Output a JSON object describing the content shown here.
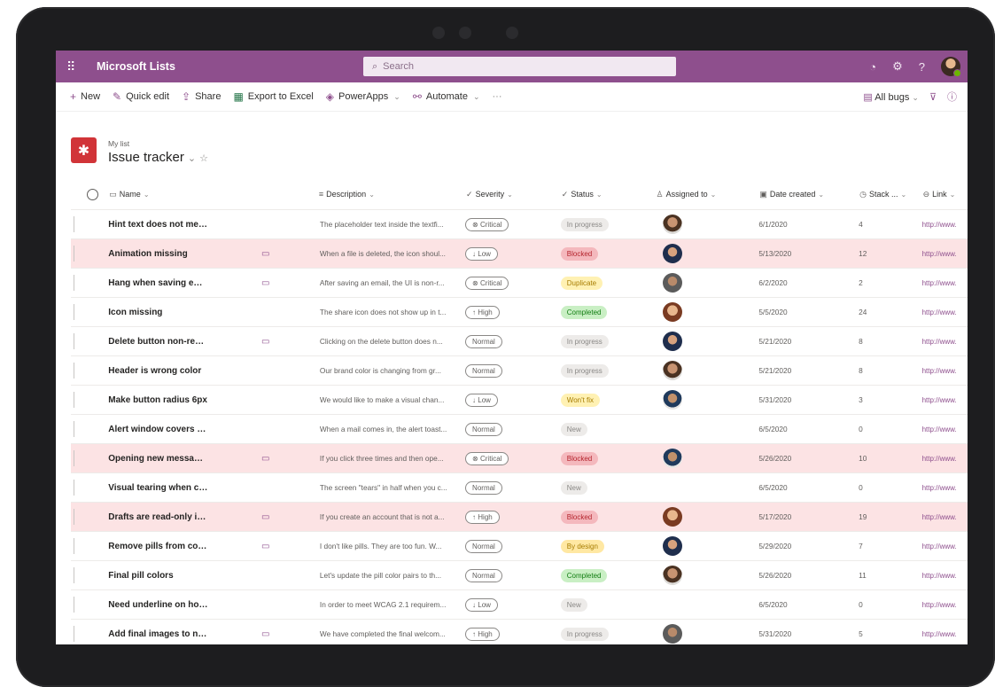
{
  "app": {
    "name": "Microsoft Lists",
    "search_placeholder": "Search"
  },
  "suite_icons": [
    "bell-icon",
    "gear-icon",
    "help-icon"
  ],
  "help_label": "?",
  "commands": {
    "new": "New",
    "quick_edit": "Quick edit",
    "share": "Share",
    "export": "Export to Excel",
    "powerapps": "PowerApps",
    "automate": "Automate",
    "more": "···",
    "view": "All bugs"
  },
  "list": {
    "subtitle": "My list",
    "title": "Issue tracker"
  },
  "columns": {
    "name": "Name",
    "description": "Description",
    "severity": "Severity",
    "status": "Status",
    "assigned": "Assigned to",
    "date": "Date created",
    "stack": "Stack ...",
    "link": "Link"
  },
  "rows": [
    {
      "name": "Hint text does not meet contrast",
      "comment": false,
      "desc": "The placeholder text inside the textfi...",
      "sev": "Critical",
      "status": "In progress",
      "avatar": "a1",
      "date": "6/1/2020",
      "stack": "4",
      "link": "http://www.",
      "selected": false
    },
    {
      "name": "Animation missing",
      "comment": true,
      "desc": "When a file is deleted, the icon shoul...",
      "sev": "Low",
      "status": "Blocked",
      "avatar": "a2",
      "date": "5/13/2020",
      "stack": "12",
      "link": "http://www.",
      "selected": true
    },
    {
      "name": "Hang when saving email",
      "comment": true,
      "desc": "After saving an email, the UI is non-r...",
      "sev": "Critical",
      "status": "Duplicate",
      "avatar": "a3",
      "date": "6/2/2020",
      "stack": "2",
      "link": "http://www.",
      "selected": false
    },
    {
      "name": "Icon missing",
      "comment": false,
      "desc": "The share icon does not show up in t...",
      "sev": "High",
      "status": "Completed",
      "avatar": "a4",
      "date": "5/5/2020",
      "stack": "24",
      "link": "http://www.",
      "selected": false
    },
    {
      "name": "Delete button non-responsive",
      "comment": true,
      "desc": "Clicking on the delete button does n...",
      "sev": "Normal",
      "status": "In progress",
      "avatar": "a2",
      "date": "5/21/2020",
      "stack": "8",
      "link": "http://www.",
      "selected": false
    },
    {
      "name": "Header is wrong color",
      "comment": false,
      "desc": "Our brand color is changing from gr...",
      "sev": "Normal",
      "status": "In progress",
      "avatar": "a1",
      "date": "5/21/2020",
      "stack": "8",
      "link": "http://www.",
      "selected": false
    },
    {
      "name": "Make button radius 6px",
      "comment": false,
      "desc": "We would like to make a visual chan...",
      "sev": "Low",
      "status": "Won't fix",
      "avatar": "a5",
      "date": "5/31/2020",
      "stack": "3",
      "link": "http://www.",
      "selected": false
    },
    {
      "name": "Alert window covers up command ...",
      "comment": false,
      "desc": "When a mail comes in, the alert toast...",
      "sev": "Normal",
      "status": "New",
      "avatar": "",
      "date": "6/5/2020",
      "stack": "0",
      "link": "http://www.",
      "selected": false
    },
    {
      "name": "Opening new message crashes syst...",
      "comment": true,
      "desc": "If you click three times and then ope...",
      "sev": "Critical",
      "status": "Blocked",
      "avatar": "a5",
      "date": "5/26/2020",
      "stack": "10",
      "link": "http://www.",
      "selected": true
    },
    {
      "name": "Visual tearing when closing dialog",
      "comment": false,
      "desc": "The screen \"tears\" in half when you c...",
      "sev": "Normal",
      "status": "New",
      "avatar": "",
      "date": "6/5/2020",
      "stack": "0",
      "link": "http://www.",
      "selected": false
    },
    {
      "name": "Drafts are read-only in external acc...",
      "comment": true,
      "desc": "If you create an account that is not a...",
      "sev": "High",
      "status": "Blocked",
      "avatar": "a4",
      "date": "5/17/2020",
      "stack": "19",
      "link": "http://www.",
      "selected": true
    },
    {
      "name": "Remove pills from column formatti...",
      "comment": true,
      "desc": "I don't like pills. They are too fun. W...",
      "sev": "Normal",
      "status": "By design",
      "avatar": "a2",
      "date": "5/29/2020",
      "stack": "7",
      "link": "http://www.",
      "selected": false
    },
    {
      "name": "Final pill colors",
      "comment": false,
      "desc": "Let's update the pill color pairs to th...",
      "sev": "Normal",
      "status": "Completed",
      "avatar": "a1",
      "date": "5/26/2020",
      "stack": "11",
      "link": "http://www.",
      "selected": false
    },
    {
      "name": "Need underline on hover of help li...",
      "comment": false,
      "desc": "In order to meet WCAG 2.1 requirem...",
      "sev": "Low",
      "status": "New",
      "avatar": "",
      "date": "6/5/2020",
      "stack": "0",
      "link": "http://www.",
      "selected": false
    },
    {
      "name": "Add final images to new message s...",
      "comment": true,
      "desc": "We have completed the final welcom...",
      "sev": "High",
      "status": "In progress",
      "avatar": "a3",
      "date": "5/31/2020",
      "stack": "5",
      "link": "http://www.",
      "selected": false
    }
  ],
  "severity_icons": {
    "Critical": "⊗",
    "Low": "↓",
    "High": "↑",
    "Normal": ""
  },
  "status_colors": {
    "In progress": {
      "bg": "#edebe9",
      "fg": "#8a8886"
    },
    "Blocked": {
      "bg": "#f4b8bd",
      "fg": "#b4232c"
    },
    "Duplicate": {
      "bg": "#fff1b3",
      "fg": "#a67c00"
    },
    "Completed": {
      "bg": "#c9efc4",
      "fg": "#107c10"
    },
    "Won't fix": {
      "bg": "#fff1b3",
      "fg": "#a67c00"
    },
    "New": {
      "bg": "#edebe9",
      "fg": "#8a8886"
    },
    "By design": {
      "bg": "#ffe8a3",
      "fg": "#a67c00"
    }
  },
  "colors": {
    "accent": "#8e4f8d",
    "selected_row": "#fce3e4",
    "list_icon": "#d13438"
  }
}
